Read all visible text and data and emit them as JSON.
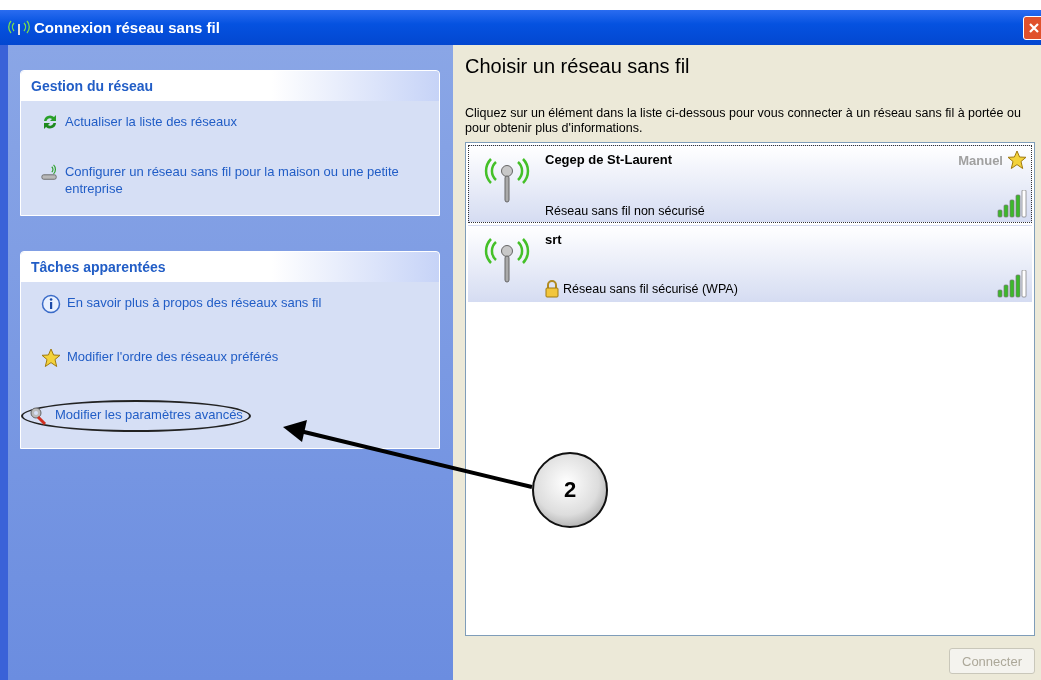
{
  "window": {
    "title": "Connexion réseau sans fil"
  },
  "sidebar": {
    "sections": [
      {
        "title": "Gestion du réseau",
        "items": [
          {
            "kind": "refresh",
            "label": "Actualiser la liste des réseaux"
          },
          {
            "kind": "setup",
            "label": "Configurer un réseau sans fil pour la maison ou une petite entreprise"
          }
        ]
      },
      {
        "title": "Tâches apparentées",
        "items": [
          {
            "kind": "info",
            "label": "En savoir plus à propos des réseaux sans fil"
          },
          {
            "kind": "star",
            "label": "Modifier l'ordre des réseaux préférés"
          },
          {
            "kind": "tools",
            "label": "Modifier les paramètres avancés",
            "highlighted": true
          }
        ]
      }
    ]
  },
  "main": {
    "heading": "Choisir un réseau sans fil",
    "description": "Cliquez sur un élément dans la liste ci-dessous pour vous connecter à un réseau sans fil à portée ou pour obtenir plus d'informations.",
    "networks": [
      {
        "name": "Cegep de St-Laurent",
        "status": "Réseau sans fil non sécurisé",
        "secured": false,
        "tag": "Manuel",
        "selected": true
      },
      {
        "name": "srt",
        "status": "Réseau sans fil sécurisé (WPA)",
        "secured": true,
        "selected": false
      }
    ],
    "connect_button": {
      "label": "Connecter",
      "disabled": true
    }
  },
  "annotation": {
    "label": "2"
  }
}
